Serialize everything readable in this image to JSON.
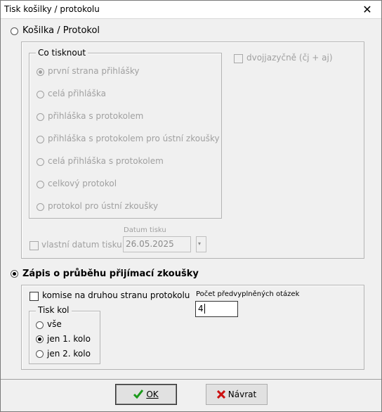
{
  "window": {
    "title": "Tisk košilky / protokolu",
    "close_glyph": "✕"
  },
  "kosilka": {
    "radio_label": "Košilka / Protokol",
    "co_tisknout": {
      "legend": "Co tisknout",
      "options": [
        "první strana přihlášky",
        "celá přihláška",
        "přihláška s protokolem",
        "přihláška s protokolem pro ústní zkoušky",
        "celá přihláška s protokolem",
        "celkový protokol",
        "protokol pro ústní zkoušky"
      ],
      "selected_index": 0
    },
    "dvojjazycne_label": "dvojjazyčně (čj + aj)",
    "vlastni_datum_label": "vlastní datum tisku",
    "datum_tisku_caption": "Datum tisku",
    "datum_tisku_value": "26.05.2025"
  },
  "zapis": {
    "radio_label": "Zápis o průběhu přijímací zkoušky",
    "komise_label": "komise na druhou stranu protokolu",
    "pocet_label": "Počet předvyplněných otázek",
    "pocet_value": "4",
    "tisk_kol": {
      "legend": "Tisk kol",
      "options": [
        "vše",
        "jen 1. kolo",
        "jen 2. kolo"
      ],
      "selected_index": 1
    }
  },
  "buttons": {
    "ok_label": "OK",
    "navrat_label": "Návrat"
  },
  "colors": {
    "ok_check": "#1a9a1a",
    "navrat_x": "#cc1111"
  }
}
